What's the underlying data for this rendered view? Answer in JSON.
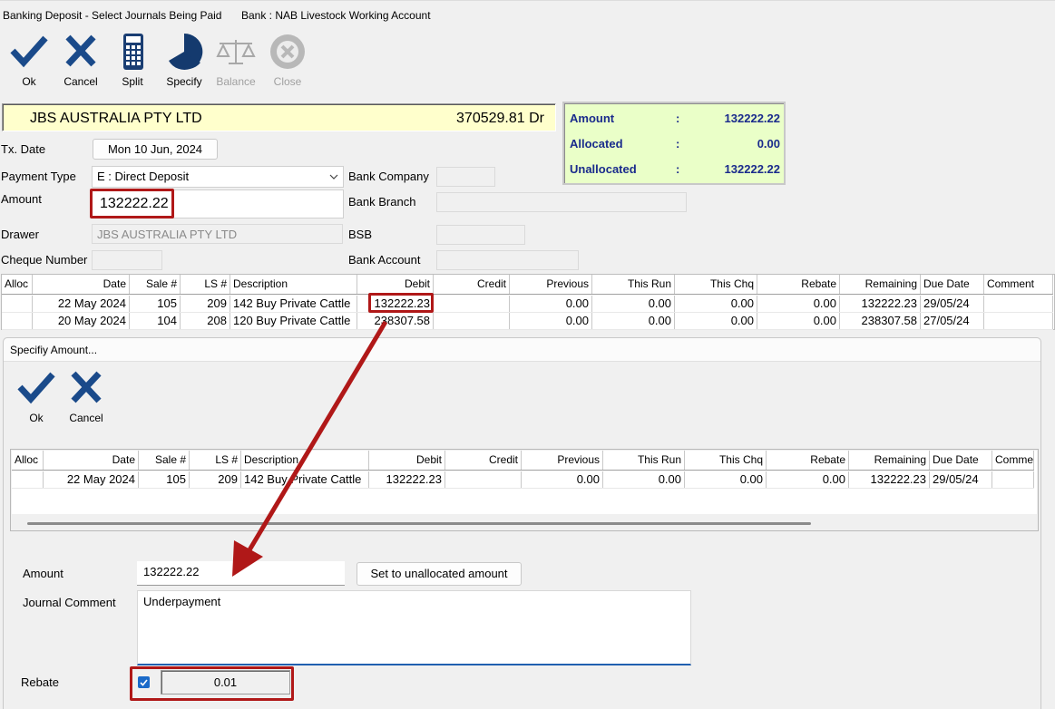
{
  "window": {
    "title": "Banking Deposit - Select Journals Being Paid",
    "bank": "Bank : NAB Livestock Working Account"
  },
  "toolbar": {
    "ok": "Ok",
    "cancel": "Cancel",
    "split": "Split",
    "specify": "Specify",
    "balance": "Balance",
    "close": "Close"
  },
  "account": {
    "name": "JBS AUSTRALIA PTY LTD",
    "balance": "370529.81 Dr"
  },
  "summary": {
    "amount_label": "Amount",
    "amount": "132222.22",
    "allocated_label": "Allocated",
    "allocated": "0.00",
    "unallocated_label": "Unallocated",
    "unallocated": "132222.22",
    "sep": ":"
  },
  "form": {
    "tx_date_label": "Tx. Date",
    "tx_date": "Mon 10 Jun, 2024",
    "payment_type_label": "Payment Type",
    "payment_type": "E : Direct Deposit",
    "amount_label": "Amount",
    "amount": "132222.22",
    "drawer_label": "Drawer",
    "drawer": "JBS AUSTRALIA PTY LTD",
    "cheque_label": "Cheque Number",
    "bank_company_label": "Bank Company",
    "bank_branch_label": "Bank Branch",
    "bsb_label": "BSB",
    "bank_account_label": "Bank Account"
  },
  "grid": {
    "headers": [
      "Alloc",
      "Date",
      "Sale #",
      "LS #",
      "Description",
      "Debit",
      "Credit",
      "Previous",
      "This Run",
      "This Chq",
      "Rebate",
      "Remaining",
      "Due Date",
      "Comment"
    ],
    "rows": [
      [
        "",
        "22 May 2024",
        "105",
        "209",
        "142 Buy Private Cattle",
        "132222.23",
        "",
        "0.00",
        "0.00",
        "0.00",
        "0.00",
        "132222.23",
        "29/05/24",
        ""
      ],
      [
        "",
        "20 May 2024",
        "104",
        "208",
        "120 Buy Private Cattle",
        "238307.58",
        "",
        "0.00",
        "0.00",
        "0.00",
        "0.00",
        "238307.58",
        "27/05/24",
        ""
      ]
    ]
  },
  "dialog": {
    "title": "Specifiy Amount...",
    "ok": "Ok",
    "cancel": "Cancel",
    "headers": [
      "Alloc",
      "Date",
      "Sale #",
      "LS #",
      "Description",
      "Debit",
      "Credit",
      "Previous",
      "This Run",
      "This Chq",
      "Rebate",
      "Remaining",
      "Due Date",
      "Comment"
    ],
    "rows": [
      [
        "",
        "22 May 2024",
        "105",
        "209",
        "142 Buy Private Cattle",
        "132222.23",
        "",
        "0.00",
        "0.00",
        "0.00",
        "0.00",
        "132222.23",
        "29/05/24",
        ""
      ]
    ],
    "amount_label": "Amount",
    "amount": "132222.22",
    "set_unallocated": "Set to unallocated amount",
    "comment_label": "Journal Comment",
    "comment": "Underpayment",
    "rebate_label": "Rebate",
    "rebate_checked": true,
    "rebate": "0.01"
  },
  "colors": {
    "icon_blue": "#1a4a8a",
    "annotation_red": "#b01818",
    "summary_bg": "#eaffc8",
    "account_bg": "#ffffcc"
  }
}
